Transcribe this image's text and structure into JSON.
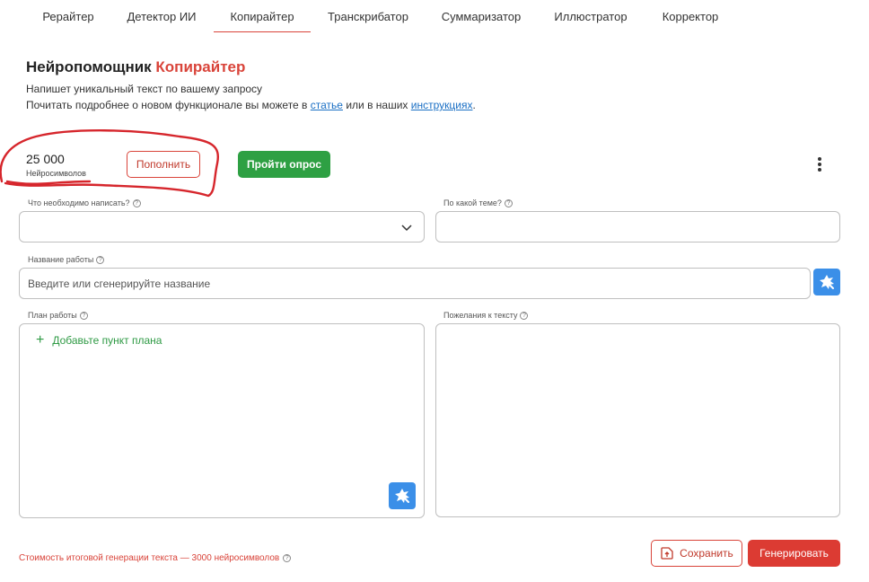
{
  "tabs": [
    {
      "label": "Рерайтер"
    },
    {
      "label": "Детектор ИИ"
    },
    {
      "label": "Копирайтер"
    },
    {
      "label": "Транскрибатор"
    },
    {
      "label": "Суммаризатор"
    },
    {
      "label": "Иллюстратор"
    },
    {
      "label": "Корректор"
    }
  ],
  "active_tab": "Копирайтер",
  "header": {
    "title_prefix": "Нейропомощник",
    "title_accent": "Копирайтер",
    "subtitle": "Напишет уникальный текст по вашему запросу",
    "info_text_1": "Почитать подробнее о новом функционале вы можете в",
    "info_link_1": "статье",
    "info_text_2": "или в наших",
    "info_link_2": "инструкциях",
    "info_text_3": "."
  },
  "balance": {
    "value": "25 000",
    "caption": "Нейросимволов",
    "topup_label": "Пополнить",
    "survey_label": "Пройти опрос"
  },
  "form": {
    "what_label": "Что необходимо написать?",
    "what_value": "",
    "topic_label": "По какой теме?",
    "topic_value": "",
    "name_label": "Название работы",
    "name_placeholder": "Введите или сгенерируйте название",
    "plan_label": "План работы",
    "plan_add_label": "Добавьте пункт плана",
    "wishes_label": "Пожелания к тексту"
  },
  "footer": {
    "cost_text": "Стоимость итоговой генерации текста — 3000 нейросимволов",
    "save_label": "Сохранить",
    "generate_label": "Генерировать"
  },
  "colors": {
    "accent": "#d9443a",
    "green": "#2ea043",
    "blue": "#3b8fe8",
    "link": "#1a6fc4"
  },
  "icons": {
    "magic": "magic-wand-icon",
    "help": "question-icon",
    "more": "more-vertical-icon",
    "save": "save-file-icon",
    "chevron": "chevron-down-icon",
    "plus": "plus-icon"
  }
}
